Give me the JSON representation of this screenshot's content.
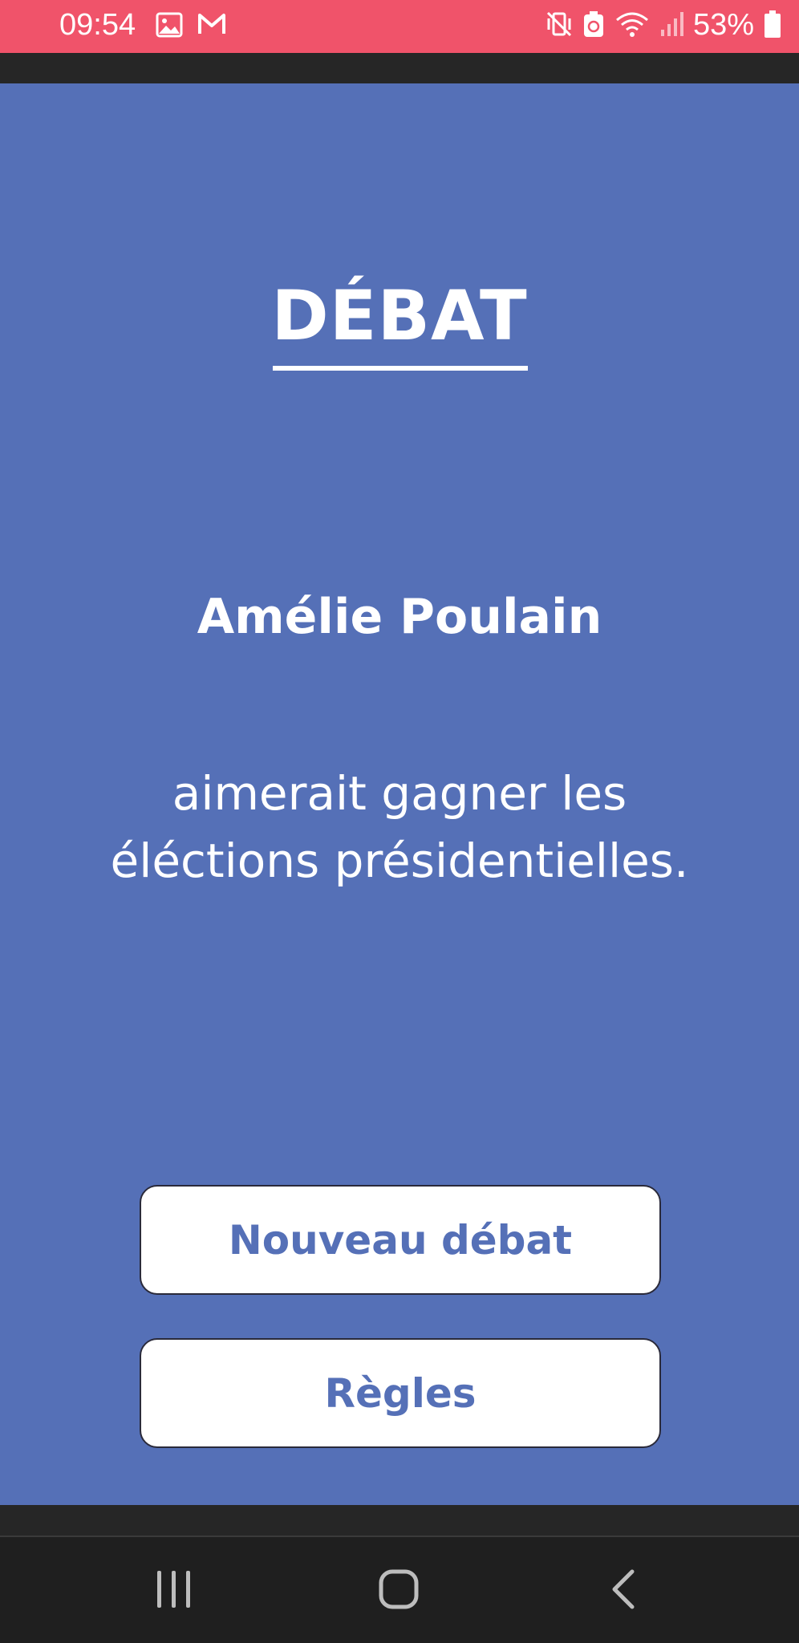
{
  "status_bar": {
    "time": "09:54",
    "battery_percent": "53%",
    "left_icons": [
      "image-icon",
      "gmail-icon"
    ],
    "right_icons": [
      "mute-vibrate-icon",
      "battery-saver-icon",
      "wifi-icon",
      "signal-icon",
      "battery-icon"
    ],
    "background_color": "#f0536a"
  },
  "app": {
    "title": "DÉBAT",
    "player_name": "Amélie Poulain",
    "statement": "aimerait gagner les éléctions présidentielles.",
    "background_color": "#5570b7"
  },
  "buttons": {
    "new_debate": "Nouveau débat",
    "rules": "Règles"
  },
  "nav_bar": {
    "icons": [
      "recent-apps-icon",
      "home-icon",
      "back-icon"
    ]
  }
}
